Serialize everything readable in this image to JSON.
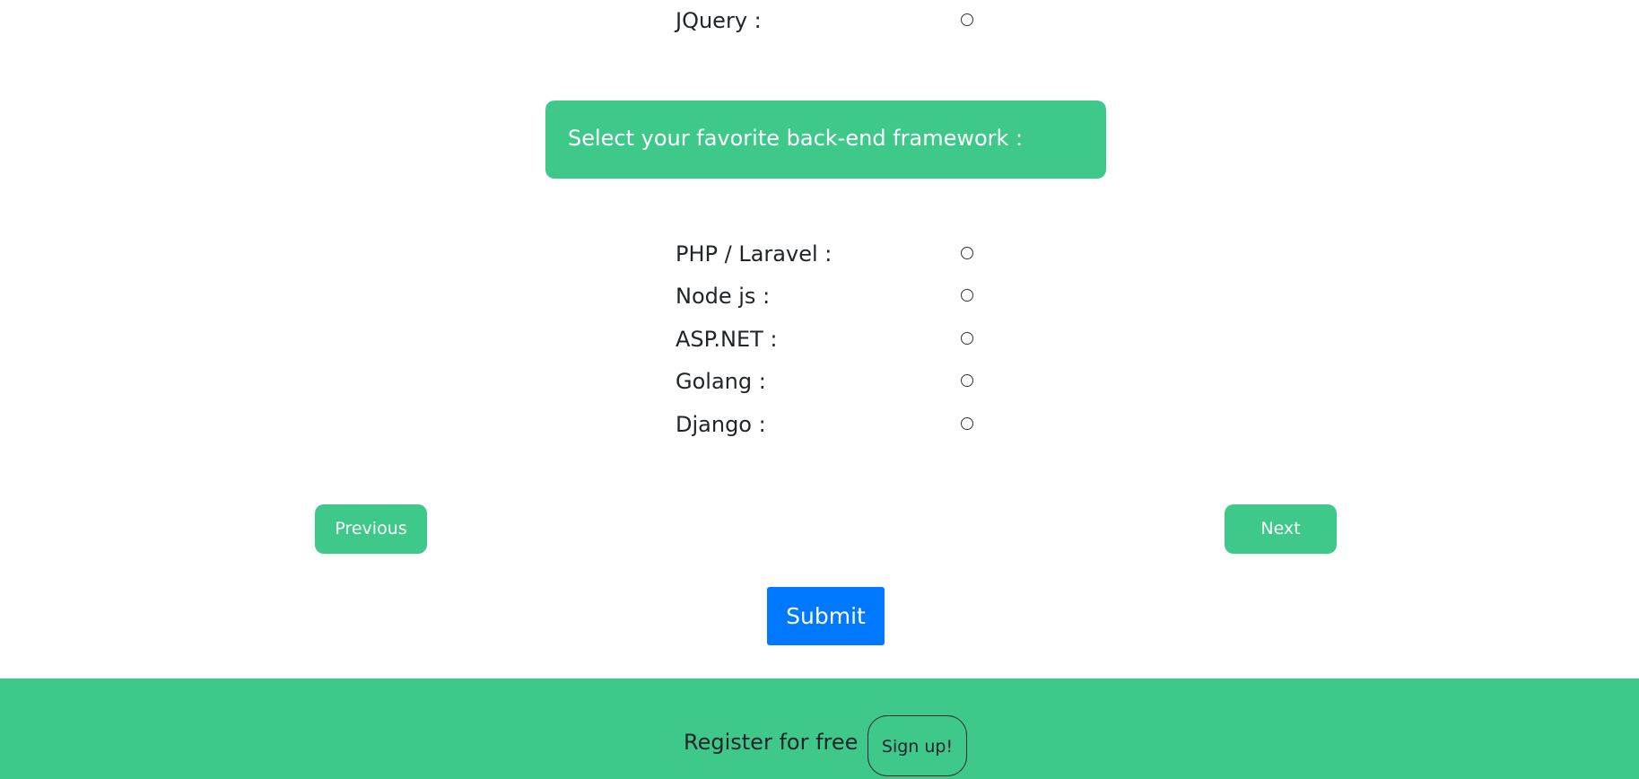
{
  "top_option": {
    "label": "JQuery :"
  },
  "question": {
    "text": "Select your favorite back-end framework :"
  },
  "options": [
    {
      "label": "PHP / Laravel :"
    },
    {
      "label": "Node js :"
    },
    {
      "label": "ASP.NET :"
    },
    {
      "label": "Golang :"
    },
    {
      "label": "Django :"
    }
  ],
  "navigation": {
    "previous_label": "Previous",
    "next_label": "Next"
  },
  "submit_label": "Submit",
  "footer": {
    "text": "Register for free",
    "signup_label": "Sign up!"
  },
  "colors": {
    "accent_green": "#3ec98b",
    "submit_blue": "#0078ff"
  }
}
